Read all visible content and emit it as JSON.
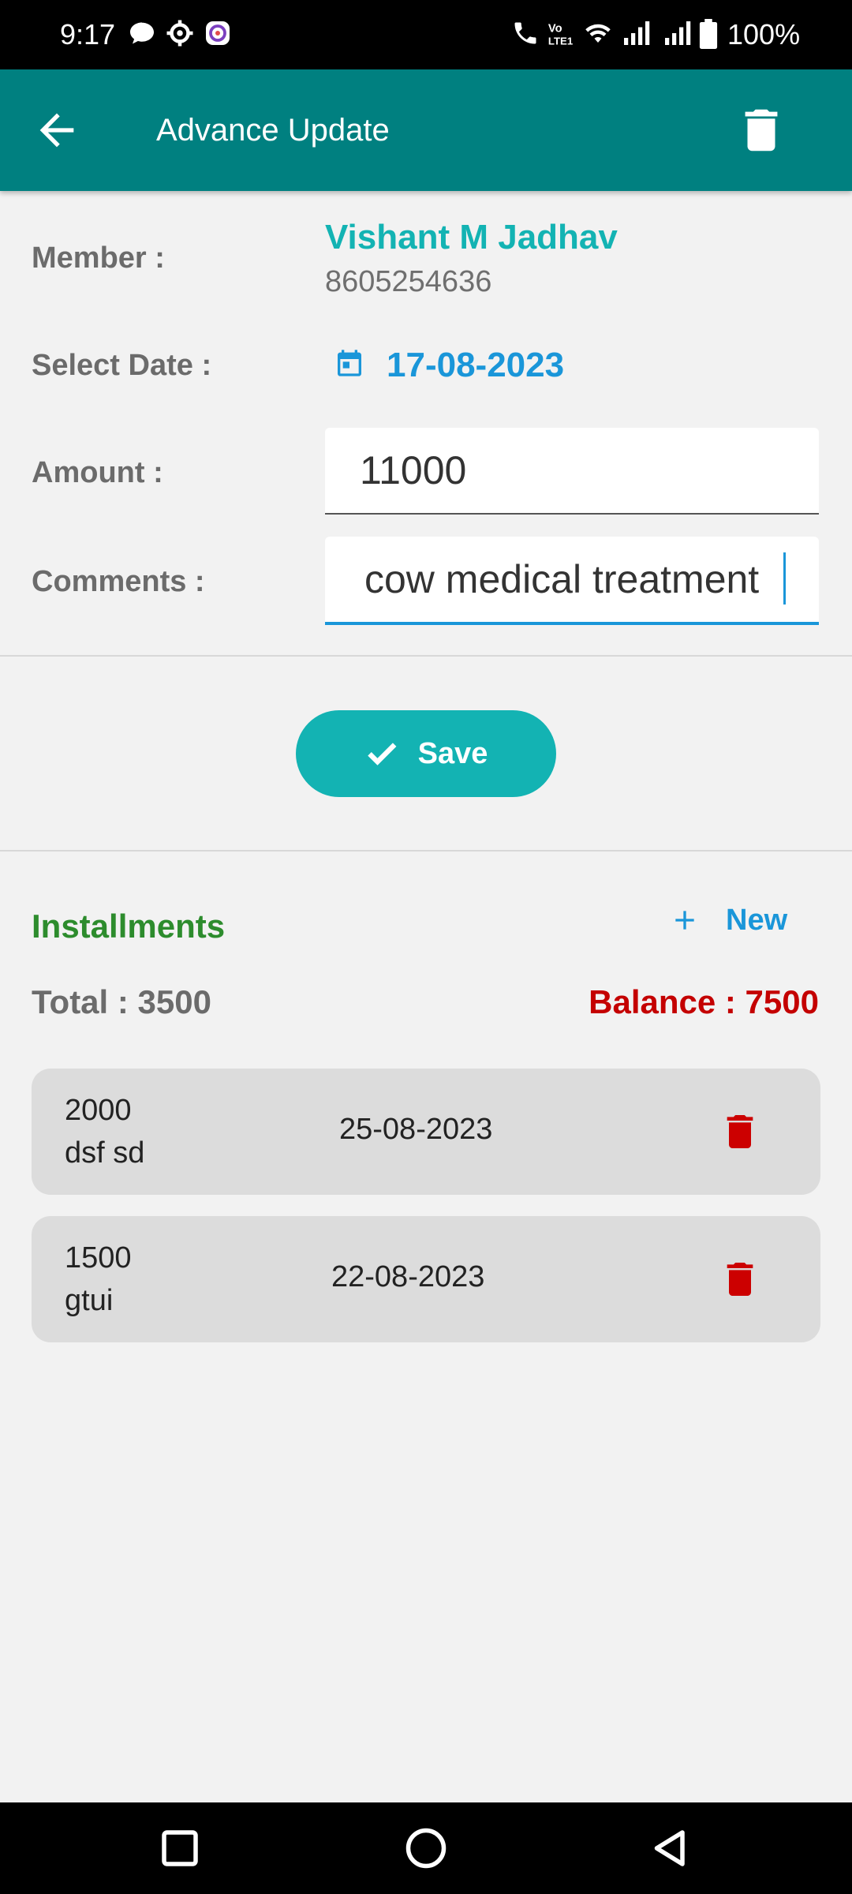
{
  "status_bar": {
    "time": "9:17",
    "battery": "100%"
  },
  "header": {
    "title": "Advance Update"
  },
  "form": {
    "member_label": "Member :",
    "member_name": "Vishant M Jadhav",
    "member_phone": "8605254636",
    "date_label": "Select Date :",
    "date_value": "17-08-2023",
    "amount_label": "Amount :",
    "amount_value": "11000",
    "comments_label": "Comments :",
    "comments_value": "cow medical treatment",
    "save_label": "Save"
  },
  "installments": {
    "title": "Installments",
    "new_label": "New",
    "total": "Total : 3500",
    "balance": "Balance : 7500",
    "items": [
      {
        "amount": "2000",
        "note": "dsf sd",
        "date": "25-08-2023"
      },
      {
        "amount": "1500",
        "note": "gtui",
        "date": "22-08-2023"
      }
    ]
  },
  "colors": {
    "app_bar": "#008080",
    "accent_teal": "#13b3b3",
    "accent_blue": "#1a96d9",
    "installments_green": "#2d8c2d",
    "balance_red": "#c40000"
  }
}
